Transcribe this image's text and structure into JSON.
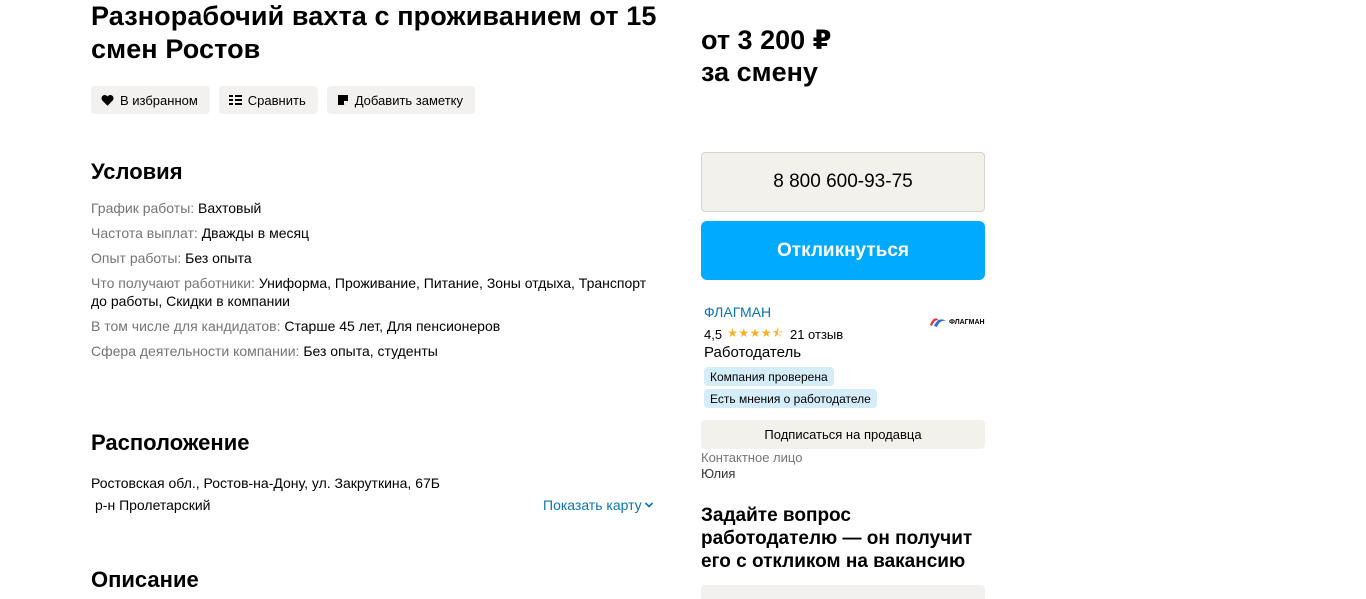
{
  "title": "Разнорабочий вахта с проживанием от 15 смен Ростов",
  "actions": {
    "favorite": "В избранном",
    "compare": "Сравнить",
    "note": "Добавить заметку"
  },
  "conditions": {
    "heading": "Условия",
    "items": [
      {
        "key": "График работы:",
        "value": "Вахтовый"
      },
      {
        "key": "Частота выплат:",
        "value": "Дважды в месяц"
      },
      {
        "key": "Опыт работы:",
        "value": "Без опыта"
      },
      {
        "key": "Что получают работники:",
        "value": "Униформа, Проживание, Питание, Зоны отдыха, Транспорт до работы, Скидки в компании"
      },
      {
        "key": "В том числе для кандидатов:",
        "value": "Старше 45 лет, Для пенсионеров"
      },
      {
        "key": "Сфера деятельности компании:",
        "value": "Без опыта, студенты"
      }
    ]
  },
  "location": {
    "heading": "Расположение",
    "address": "Ростовская обл., Ростов-на-Дону, ул. Закруткина, 67Б",
    "district": "р-н Пролетарский",
    "show_map": "Показать карту"
  },
  "description": {
    "heading": "Описание"
  },
  "sidebar": {
    "price_line1": "от 3 200 ₽",
    "price_line2": "за смену",
    "phone": "8 800 600-93-75",
    "apply": "Откликнуться",
    "seller": {
      "name": "ФЛАГМАН",
      "rating": "4,5",
      "stars": "★★★★⯪",
      "reviews": "21 отзыв",
      "role": "Работодатель",
      "badge_verified": "Компания проверена",
      "badge_opinions": "Есть мнения о работодателе",
      "logo_text": "ФЛАГМАН"
    },
    "subscribe": "Подписаться на продавца",
    "contact_label": "Контактное лицо",
    "contact_name": "Юлия",
    "ask_heading": "Задайте вопрос работодателю — он получит его с откликом на вакансию"
  },
  "colors": {
    "accent": "#00aaff",
    "link": "#0a74b8",
    "star": "#ffb021",
    "badge": "#d5ecf9"
  }
}
